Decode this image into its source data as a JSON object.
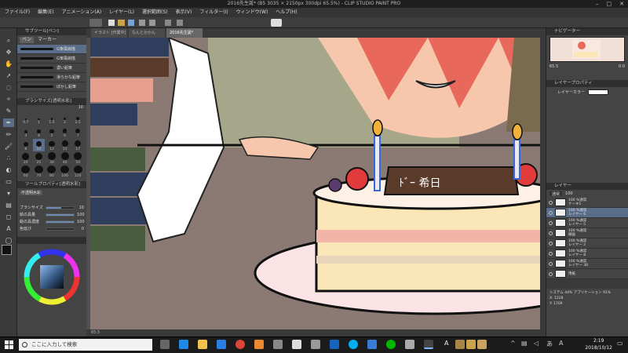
{
  "window": {
    "title": "2016先生誕* (B5 3035 × 2150px 300dpi 65.5%) - CLIP STUDIO PAINT PRO"
  },
  "menu": [
    "ファイル(F)",
    "編集(E)",
    "アニメーション(A)",
    "レイヤー(L)",
    "選択範囲(S)",
    "表示(V)",
    "フィルター(I)",
    "ウィンドウ(W)",
    "ヘルプ(H)"
  ],
  "subtool": {
    "header": "サブツール[ペン]",
    "tabs": [
      "ペン",
      "マーカー"
    ],
    "brushes": [
      "G筆風線描",
      "G筆風線描",
      "濃い鉛筆",
      "滑らかな鉛筆",
      "ぼかし鉛筆"
    ]
  },
  "brush_sizes": {
    "header": "ブラシサイズ[透明水彩]",
    "current": "10",
    "values": [
      "0.7",
      "1",
      "1.5",
      "2",
      "2.5",
      "3",
      "4",
      "5",
      "6",
      "7",
      "8",
      "10",
      "12",
      "15",
      "17",
      "20",
      "25",
      "30",
      "40",
      "50",
      "60",
      "70",
      "80",
      "100",
      "120"
    ]
  },
  "tool_property": {
    "header": "ツールプロパティ[透明水彩]",
    "tool_name": "不透明水彩",
    "rows": [
      {
        "label": "ブラシサイズ",
        "value": "10",
        "level": 0.55
      },
      {
        "label": "絵の具量",
        "value": "100",
        "level": 1.0
      },
      {
        "label": "絵の具濃度",
        "value": "100",
        "level": 1.0
      },
      {
        "label": "色延び",
        "value": "0",
        "level": 0.0
      }
    ]
  },
  "canvas": {
    "tabs": [
      "イラスト [作業中]",
      "なんとかかん",
      "2016先生誕*"
    ],
    "status": "65.5"
  },
  "navigator": {
    "header": "ナビゲーター",
    "zoom": "65.5",
    "angle": "0.0"
  },
  "layer_property": {
    "header": "レイヤープロパティ",
    "label": "レイヤーカラー"
  },
  "layers": {
    "header": "レイヤー",
    "mode": "通常",
    "opacity": "100",
    "items": [
      {
        "l1": "100 %通常",
        "l2": "ケーキ1"
      },
      {
        "l1": "100 %通常",
        "l2": "レイヤー 6"
      },
      {
        "l1": "100 %通常",
        "l2": "レイヤー 5"
      },
      {
        "l1": "100 %通常",
        "l2": "線画"
      },
      {
        "l1": "100 %通常",
        "l2": "レイヤー 2"
      },
      {
        "l1": "100 %通常",
        "l2": "レイヤー 8"
      },
      {
        "l1": "100 %通常",
        "l2": "レイヤー 38"
      },
      {
        "l1": "",
        "l2": "用紙"
      }
    ]
  },
  "sysinfo": {
    "line1": "システム 44% アプリケーション 91%",
    "x": "X: 1228",
    "y": "Y: 1709"
  },
  "taskbar": {
    "search": "ここに入力して検索",
    "time": "2:19",
    "date": "2018/10/12",
    "lang": "A"
  },
  "colors": {
    "accent": "#6b8bb3",
    "bg": "#444444"
  }
}
